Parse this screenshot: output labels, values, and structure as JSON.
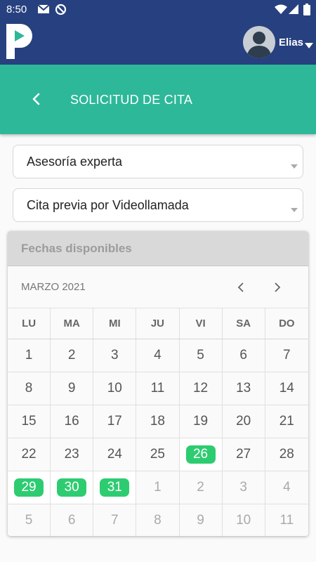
{
  "status_bar": {
    "time": "8:50"
  },
  "header": {
    "user_name": "Elias"
  },
  "title_bar": {
    "title": "SOLICITUD DE CITA"
  },
  "selects": {
    "service": "Asesoría experta",
    "mode": "Cita previa por Videollamada"
  },
  "calendar": {
    "header": "Fechas disponibles",
    "month": "MARZO 2021",
    "weekdays": [
      "LU",
      "MA",
      "MI",
      "JU",
      "VI",
      "SA",
      "DO"
    ],
    "weeks": [
      [
        {
          "d": "1",
          "s": "normal"
        },
        {
          "d": "2",
          "s": "normal"
        },
        {
          "d": "3",
          "s": "normal"
        },
        {
          "d": "4",
          "s": "normal"
        },
        {
          "d": "5",
          "s": "normal"
        },
        {
          "d": "6",
          "s": "normal"
        },
        {
          "d": "7",
          "s": "normal"
        }
      ],
      [
        {
          "d": "8",
          "s": "normal"
        },
        {
          "d": "9",
          "s": "normal"
        },
        {
          "d": "10",
          "s": "normal"
        },
        {
          "d": "11",
          "s": "normal"
        },
        {
          "d": "12",
          "s": "normal"
        },
        {
          "d": "13",
          "s": "normal"
        },
        {
          "d": "14",
          "s": "normal"
        }
      ],
      [
        {
          "d": "15",
          "s": "normal"
        },
        {
          "d": "16",
          "s": "normal"
        },
        {
          "d": "17",
          "s": "normal"
        },
        {
          "d": "18",
          "s": "normal"
        },
        {
          "d": "19",
          "s": "normal"
        },
        {
          "d": "20",
          "s": "normal"
        },
        {
          "d": "21",
          "s": "normal"
        }
      ],
      [
        {
          "d": "22",
          "s": "normal"
        },
        {
          "d": "23",
          "s": "normal"
        },
        {
          "d": "24",
          "s": "normal"
        },
        {
          "d": "25",
          "s": "normal"
        },
        {
          "d": "26",
          "s": "available"
        },
        {
          "d": "27",
          "s": "normal"
        },
        {
          "d": "28",
          "s": "normal"
        }
      ],
      [
        {
          "d": "29",
          "s": "available"
        },
        {
          "d": "30",
          "s": "available"
        },
        {
          "d": "31",
          "s": "available"
        },
        {
          "d": "1",
          "s": "outside"
        },
        {
          "d": "2",
          "s": "outside"
        },
        {
          "d": "3",
          "s": "outside"
        },
        {
          "d": "4",
          "s": "outside"
        }
      ],
      [
        {
          "d": "5",
          "s": "outside"
        },
        {
          "d": "6",
          "s": "outside"
        },
        {
          "d": "7",
          "s": "outside"
        },
        {
          "d": "8",
          "s": "outside"
        },
        {
          "d": "9",
          "s": "outside"
        },
        {
          "d": "10",
          "s": "outside"
        },
        {
          "d": "11",
          "s": "outside"
        }
      ]
    ]
  },
  "colors": {
    "header_bg": "#27407f",
    "accent": "#2db899",
    "available_day": "#2ecc71"
  },
  "icons": {
    "status_bar": [
      "mail-icon",
      "sync-icon",
      "wifi-icon",
      "signal-icon",
      "battery-icon"
    ],
    "header": [
      "app-logo",
      "avatar-icon",
      "chevron-down-icon"
    ],
    "title_bar": [
      "back-arrow-icon"
    ],
    "calendar": [
      "chevron-left-icon",
      "chevron-right-icon"
    ]
  }
}
